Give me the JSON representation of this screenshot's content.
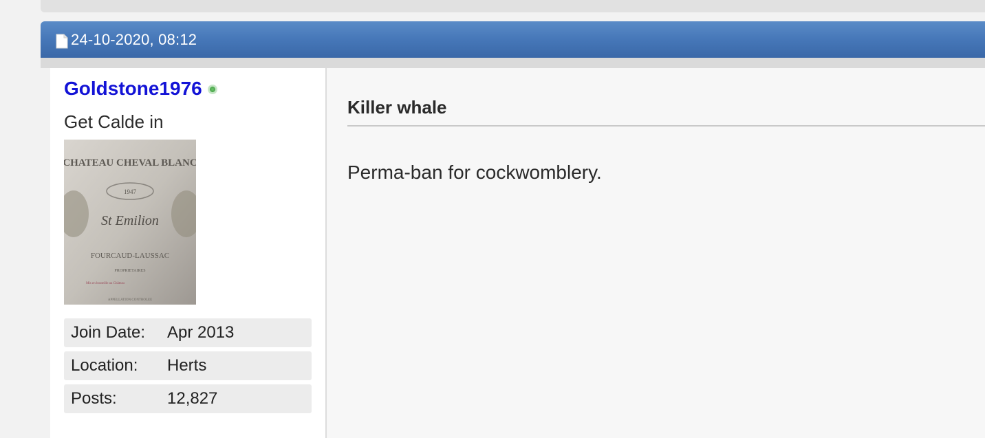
{
  "post": {
    "date": "24-10-2020, 08:12",
    "icon": "document-icon",
    "title": "Killer whale",
    "message": "Perma-ban for cockwomblery."
  },
  "user": {
    "username": "Goldstone1976",
    "status": "online",
    "status_color": "#4aa64a",
    "usertitle": "Get Calde in",
    "avatar_icon": "wine-label-avatar",
    "avatar_text": {
      "line1": "CHATEAU CHEVAL BLANC",
      "line2": "1947",
      "line3": "St Emilion",
      "line4": "FOURCAUD-LAUSSAC",
      "line5": "PROPRIETAIRES",
      "line6": "Mis en bouteille au Château",
      "line7": "APPELLATION CONTROLEE"
    },
    "stats": [
      {
        "label": "Join Date:",
        "value": "Apr 2013"
      },
      {
        "label": "Location:",
        "value": "Herts"
      },
      {
        "label": "Posts:",
        "value": "12,827"
      }
    ]
  },
  "colors": {
    "header_blue": "#4677b8",
    "username": "#1313d6"
  }
}
